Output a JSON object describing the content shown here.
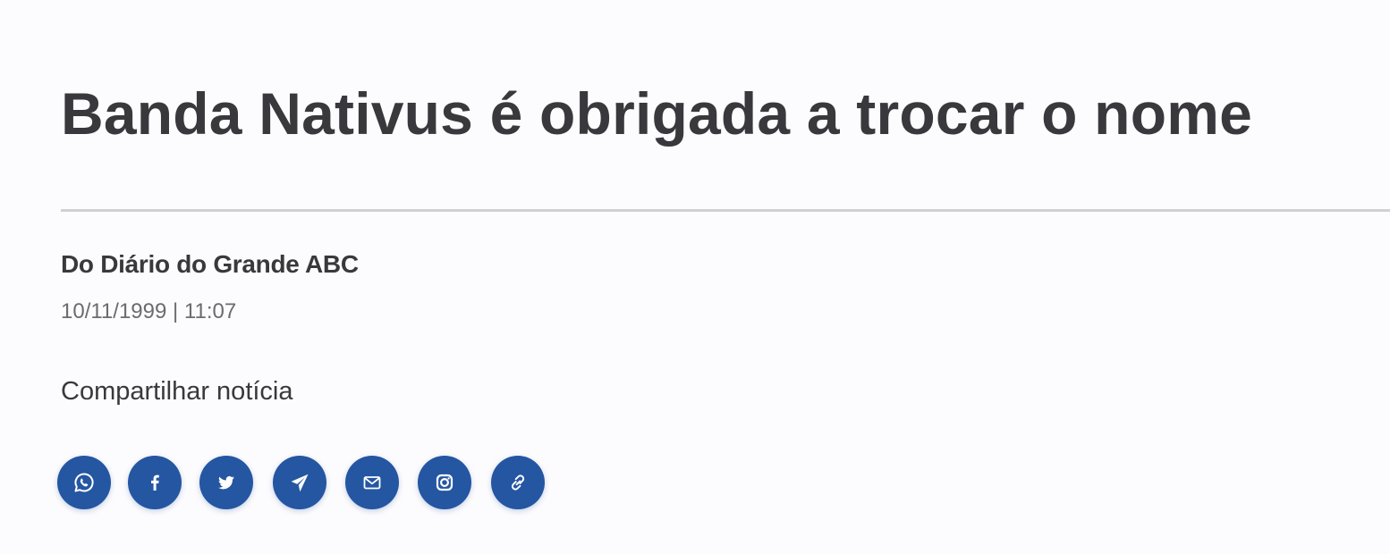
{
  "article": {
    "headline": "Banda Nativus é obrigada a trocar o nome",
    "source": "Do Diário do Grande ABC",
    "datetime": "10/11/1999 | 11:07"
  },
  "share": {
    "label": "Compartilhar notícia",
    "button_color": "#2456a2",
    "buttons": [
      {
        "icon": "whatsapp-icon"
      },
      {
        "icon": "facebook-icon"
      },
      {
        "icon": "twitter-icon"
      },
      {
        "icon": "telegram-icon"
      },
      {
        "icon": "email-icon"
      },
      {
        "icon": "instagram-icon"
      },
      {
        "icon": "link-icon"
      }
    ]
  }
}
